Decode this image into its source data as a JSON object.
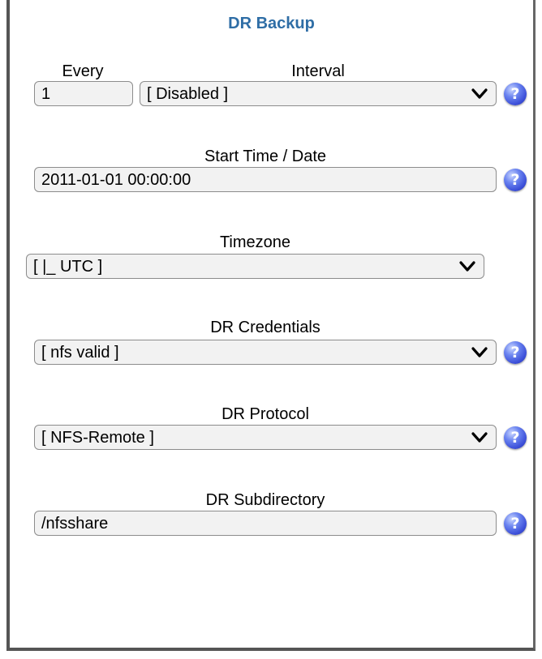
{
  "title": "DR Backup",
  "every": {
    "label": "Every",
    "value": "1"
  },
  "interval": {
    "label": "Interval",
    "value": "[ Disabled ]"
  },
  "start": {
    "label": "Start Time / Date",
    "value": "2011-01-01 00:00:00"
  },
  "timezone": {
    "label": "Timezone",
    "value": "[ |_ UTC ]"
  },
  "credentials": {
    "label": "DR Credentials",
    "value": "[ nfs valid ]"
  },
  "protocol": {
    "label": "DR Protocol",
    "value": "[ NFS-Remote ]"
  },
  "subdirectory": {
    "label": "DR Subdirectory",
    "value": "/nfsshare"
  },
  "help": {
    "glyph": "?",
    "icon": "help-icon",
    "color": "#3c4fd8"
  },
  "colors": {
    "title": "#2f6ea6",
    "field_bg": "#f2f2f2",
    "field_border": "#8c8c8c"
  }
}
